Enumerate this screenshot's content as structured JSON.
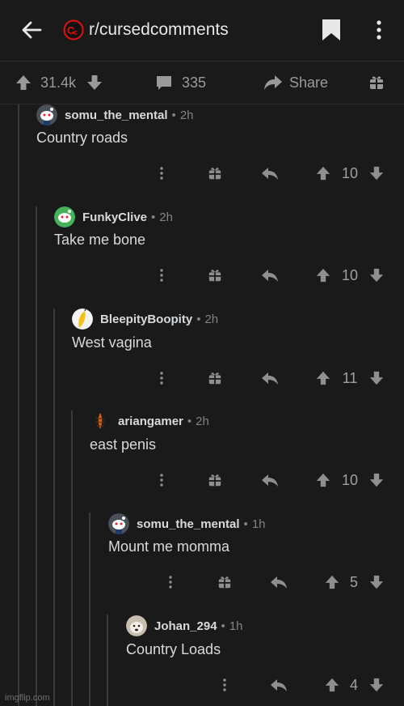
{
  "header": {
    "subreddit": "r/cursedcomments"
  },
  "post_actions": {
    "upvotes": "31.4k",
    "comments": "335",
    "share_label": "Share"
  },
  "comments": [
    {
      "user": "somu_the_mental",
      "age": "2h",
      "text": "Country roads",
      "score": "10"
    },
    {
      "user": "FunkyClive",
      "age": "2h",
      "text": "Take me bone",
      "score": "10"
    },
    {
      "user": "BleepityBoopity",
      "age": "2h",
      "text": "West vagina",
      "score": "11"
    },
    {
      "user": "ariangamer",
      "age": "2h",
      "text": "east penis",
      "score": "10"
    },
    {
      "user": "somu_the_mental",
      "age": "1h",
      "text": "Mount me momma",
      "score": "5"
    },
    {
      "user": "Johan_294",
      "age": "1h",
      "text": "Country Loads",
      "score": "4"
    }
  ],
  "watermark": "imgflip.com",
  "colors": {
    "background": "#1a1a1b",
    "text": "#d7dadc",
    "muted": "#818384",
    "icon": "#8f8f91"
  }
}
